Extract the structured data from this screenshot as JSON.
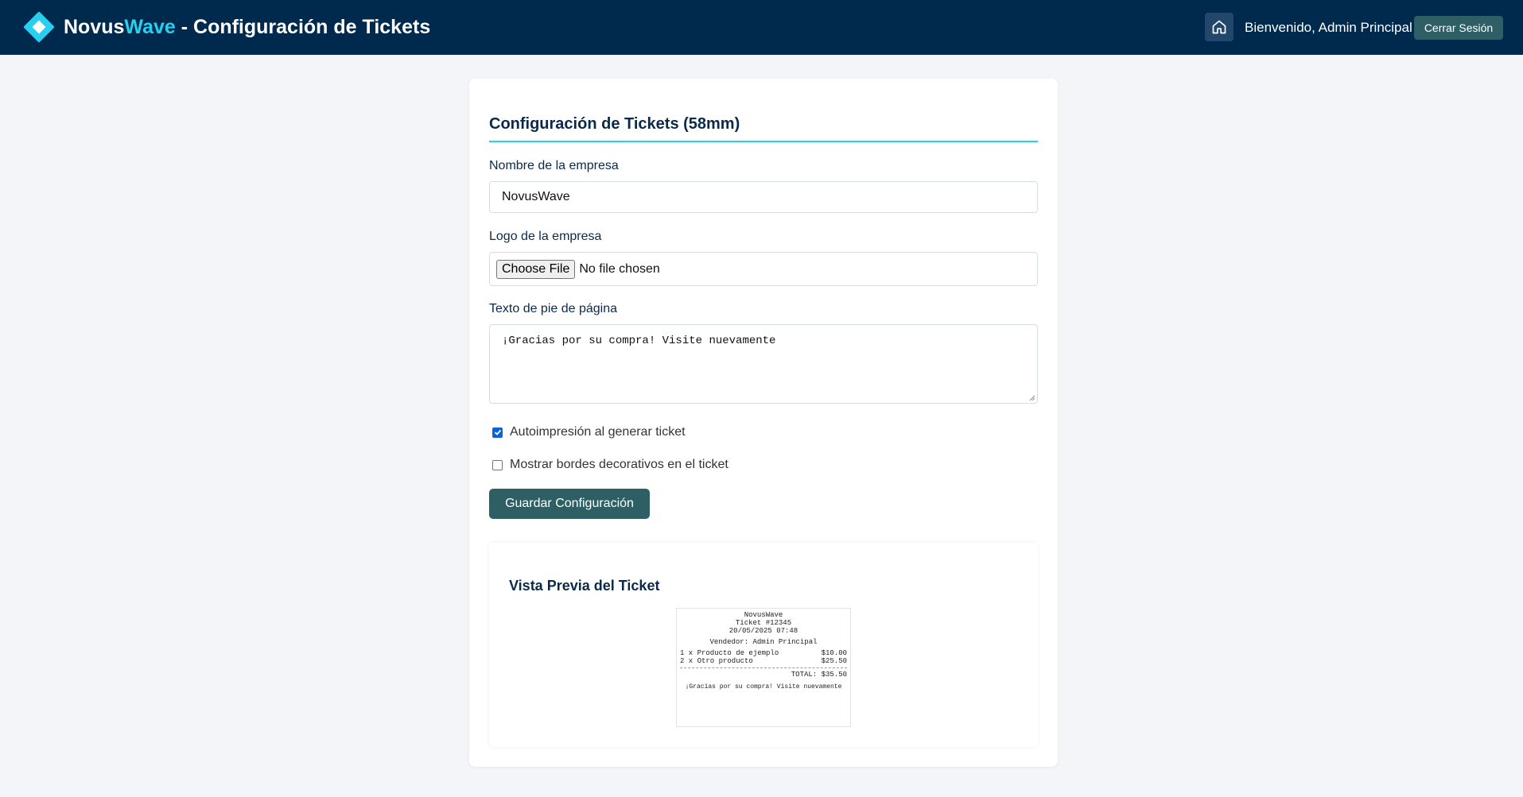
{
  "header": {
    "brand_part1": "Novus",
    "brand_part2": "Wave",
    "brand_part3": " - Configuración de Tickets",
    "welcome": "Bienvenido, Admin Principal",
    "logout_label": "Cerrar Sesión"
  },
  "form": {
    "title": "Configuración de Tickets (58mm)",
    "company_label": "Nombre de la empresa",
    "company_value": "NovusWave",
    "logo_label": "Logo de la empresa",
    "file_button": "Choose File",
    "file_status": "No file chosen",
    "footer_label": "Texto de pie de página",
    "footer_value": "¡Gracias por su compra! Visite nuevamente",
    "autoprint_label": "Autoimpresión al generar ticket",
    "autoprint_checked": true,
    "borders_label": "Mostrar bordes decorativos en el ticket",
    "borders_checked": false,
    "save_label": "Guardar Configuración"
  },
  "preview": {
    "title": "Vista Previa del Ticket",
    "ticket": {
      "company": "NovusWave",
      "number": "Ticket #12345",
      "datetime": "20/05/2025 07:48",
      "seller": "Vendedor: Admin Principal",
      "items": [
        {
          "desc": "1 x Producto de ejemplo",
          "price": "$10.00"
        },
        {
          "desc": "2 x Otro producto",
          "price": "$25.50"
        }
      ],
      "total": "TOTAL: $35.50",
      "footer": "¡Gracias por su compra! Visite nuevamente"
    }
  },
  "colors": {
    "header_bg": "#002a4d",
    "accent": "#28d0ef",
    "button": "#2d5f64"
  },
  "icons": [
    "diamond-logo-icon",
    "home-icon"
  ]
}
